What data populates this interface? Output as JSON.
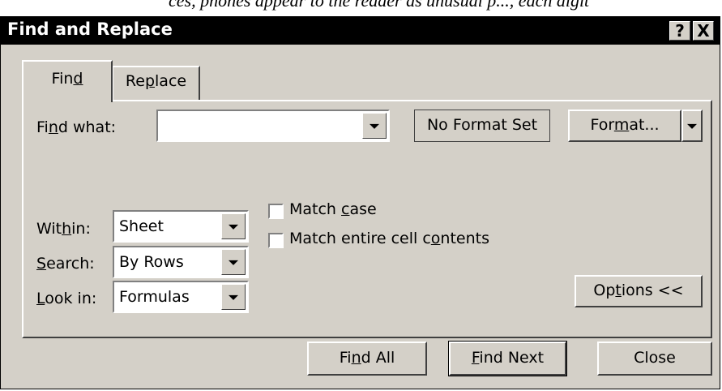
{
  "top_strip_text": "ces, phones appear to the reader as unusual p..., each digit",
  "window": {
    "title": "Find and Replace",
    "help_label": "?",
    "close_label": "X"
  },
  "tabs": [
    {
      "pre": "Fin",
      "accel": "d",
      "post": "",
      "active": true
    },
    {
      "pre": "Re",
      "accel": "p",
      "post": "lace",
      "active": false
    }
  ],
  "find": {
    "label_pre": "Fi",
    "label_accel": "n",
    "label_post": "d what:",
    "value": "",
    "format_status": "No Format Set",
    "format_btn_pre": "For",
    "format_btn_accel": "m",
    "format_btn_post": "at..."
  },
  "within": {
    "label_pre": "Wit",
    "label_accel": "h",
    "label_post": "in:",
    "value": "Sheet"
  },
  "search": {
    "label_pre": "",
    "label_accel": "S",
    "label_post": "earch:",
    "value": "By Rows"
  },
  "look_in": {
    "label_pre": "",
    "label_accel": "L",
    "label_post": "ook in:",
    "value": "Formulas"
  },
  "match_case": {
    "pre": "Match ",
    "accel": "c",
    "post": "ase",
    "checked": false
  },
  "match_entire": {
    "pre": "Match entire cell c",
    "accel": "o",
    "post": "ntents",
    "checked": false
  },
  "options_btn": {
    "pre": "Op",
    "accel": "t",
    "post": "ions <<"
  },
  "buttons": {
    "find_all": {
      "pre": "Fi",
      "accel": "n",
      "post": "d All"
    },
    "find_next": {
      "pre": "",
      "accel": "F",
      "post": "ind Next"
    },
    "close": "Close"
  }
}
